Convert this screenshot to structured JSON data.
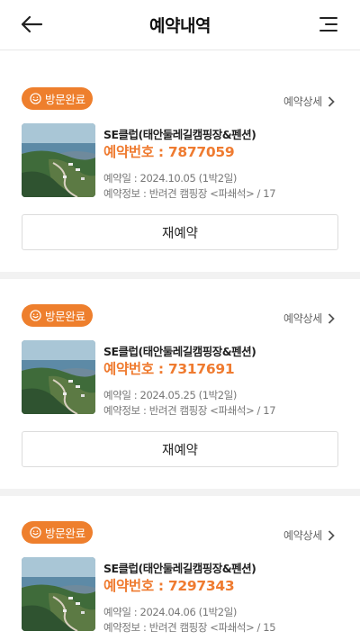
{
  "header": {
    "title": "예약내역"
  },
  "reservations": [
    {
      "badge": "방문완료",
      "detail_label": "예약상세",
      "camp_name": "SE클럽(태안둘레길캠핑장&펜션)",
      "reservation_label": "예약번호 : 7877059",
      "date_text": "예약일 : 2024.10.05 (1박2일)",
      "info_text": "예약정보 : 반려견 캠핑장 <파쇄석> / 17",
      "rebook_label": "재예약"
    },
    {
      "badge": "방문완료",
      "detail_label": "예약상세",
      "camp_name": "SE클럽(태안둘레길캠핑장&펜션)",
      "reservation_label": "예약번호 : 7317691",
      "date_text": "예약일 : 2024.05.25 (1박2일)",
      "info_text": "예약정보 : 반려견 캠핑장 <파쇄석> / 17",
      "rebook_label": "재예약"
    },
    {
      "badge": "방문완료",
      "detail_label": "예약상세",
      "camp_name": "SE클럽(태안둘레길캠핑장&펜션)",
      "reservation_label": "예약번호 : 7297343",
      "date_text": "예약일 : 2024.04.06 (1박2일)",
      "info_text": "예약정보 : 반려견 캠핑장 <파쇄석> / 15"
    }
  ],
  "colors": {
    "accent": "#ef7b30",
    "badge": "#ee7f2d"
  }
}
